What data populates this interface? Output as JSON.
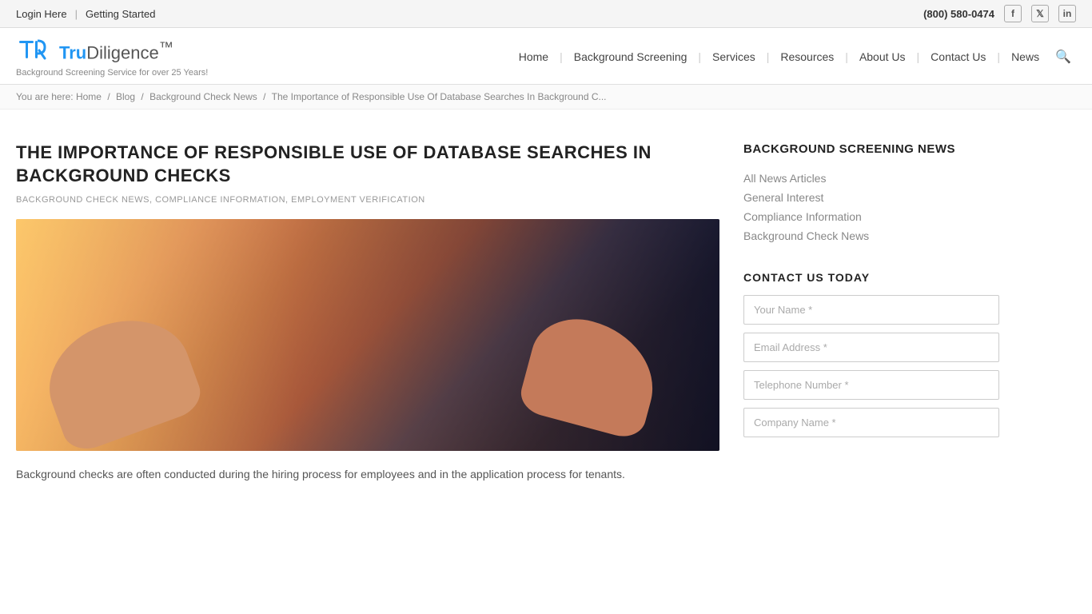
{
  "topbar": {
    "login_label": "Login Here",
    "getting_started_label": "Getting Started",
    "phone": "(800) 580-0474",
    "social": [
      {
        "name": "facebook",
        "icon": "f"
      },
      {
        "name": "twitter",
        "icon": "t"
      },
      {
        "name": "linkedin",
        "icon": "in"
      }
    ]
  },
  "header": {
    "logo_tru": "Tru",
    "logo_diligence": "Diligence",
    "logo_trademark": "™",
    "tagline": "Background Screening Service for over 25 Years!",
    "nav": [
      {
        "label": "Home"
      },
      {
        "label": "Background Screening"
      },
      {
        "label": "Services"
      },
      {
        "label": "Resources"
      },
      {
        "label": "About Us"
      },
      {
        "label": "Contact Us"
      },
      {
        "label": "News"
      }
    ]
  },
  "breadcrumb": {
    "prefix": "You are here:",
    "items": [
      {
        "label": "Home",
        "href": "#"
      },
      {
        "label": "Blog",
        "href": "#"
      },
      {
        "label": "Background Check News",
        "href": "#"
      },
      {
        "label": "The Importance of Responsible Use Of Database Searches In Background C...",
        "href": "#"
      }
    ]
  },
  "article": {
    "title": "The Importance of Responsible Use Of Database Searches In Background Checks",
    "tags": "Background Check News, Compliance Information, Employment Verification",
    "body": "Background checks are often conducted during the hiring process for employees and in the application process for tenants."
  },
  "sidebar": {
    "news_section_title": "Background Screening News",
    "news_links": [
      {
        "label": "All News Articles"
      },
      {
        "label": "General Interest"
      },
      {
        "label": "Compliance Information"
      },
      {
        "label": "Background Check News"
      }
    ],
    "contact_title": "Contact Us Today",
    "form_fields": [
      {
        "placeholder": "Your Name *",
        "type": "text",
        "name": "your-name"
      },
      {
        "placeholder": "Email Address *",
        "type": "email",
        "name": "email-address"
      },
      {
        "placeholder": "Telephone Number *",
        "type": "tel",
        "name": "telephone-number"
      },
      {
        "placeholder": "Company Name *",
        "type": "text",
        "name": "company-name"
      }
    ]
  }
}
